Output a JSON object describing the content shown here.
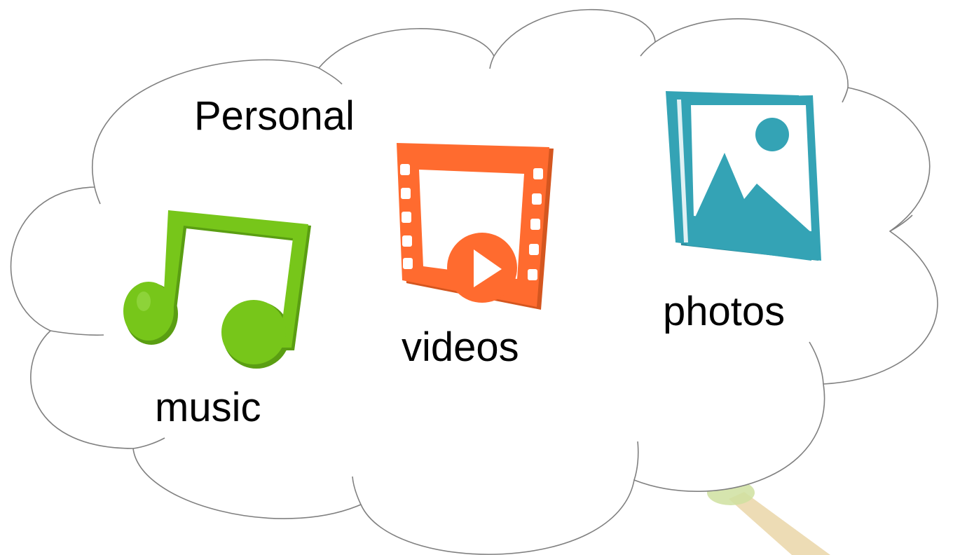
{
  "title": "Personal",
  "items": [
    {
      "label": "music",
      "icon": "music-note-icon",
      "color": "#77c61a"
    },
    {
      "label": "videos",
      "icon": "film-play-icon",
      "color": "#ff6b2f"
    },
    {
      "label": "photos",
      "icon": "photo-gallery-icon",
      "color": "#34a3b5"
    }
  ],
  "cloud": {
    "fill": "#ffffff",
    "stroke": "#808080"
  }
}
